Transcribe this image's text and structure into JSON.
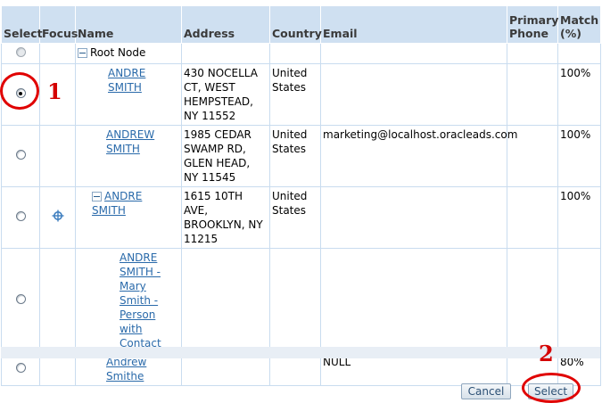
{
  "columns": {
    "select": "Select",
    "focus": "Focus",
    "name": "Name",
    "address": "Address",
    "country": "Country",
    "email": "Email",
    "phone": "Primary Phone",
    "match": "Match (%)"
  },
  "root_node_label": "Root Node",
  "rows": [
    {
      "name": "ANDRE SMITH",
      "address": "430 NOCELLA CT, WEST HEMPSTEAD, NY 11552",
      "country": "United States",
      "email": "",
      "phone": "",
      "match": "100%",
      "selected": true
    },
    {
      "name": "ANDREW SMITH",
      "address": "1985 CEDAR SWAMP RD, GLEN HEAD, NY 11545",
      "country": "United States",
      "email": "marketing@localhost.oracleads.com",
      "phone": "",
      "match": "100%",
      "selected": false
    },
    {
      "name": "ANDRE SMITH",
      "address": "1615 10TH AVE, BROOKLYN, NY 11215",
      "country": "United States",
      "email": "",
      "phone": "",
      "match": "100%",
      "selected": false,
      "focus_icon": "crosshair-icon"
    },
    {
      "name": "ANDRE SMITH - Mary Smith - Person with Contact",
      "address": "",
      "country": "",
      "email": "",
      "phone": "",
      "match": "",
      "selected": false
    },
    {
      "name": "Andrew Smithe",
      "address": "",
      "country": "",
      "email": "NULL",
      "phone": "",
      "match": "80%",
      "selected": false
    }
  ],
  "buttons": {
    "cancel": "Cancel",
    "select": "Select"
  },
  "annotations": {
    "one": "1",
    "two": "2"
  },
  "colors": {
    "header_bg": "#cfe0f1",
    "link": "#2a6aaa",
    "annotation_red": "#e00000"
  }
}
